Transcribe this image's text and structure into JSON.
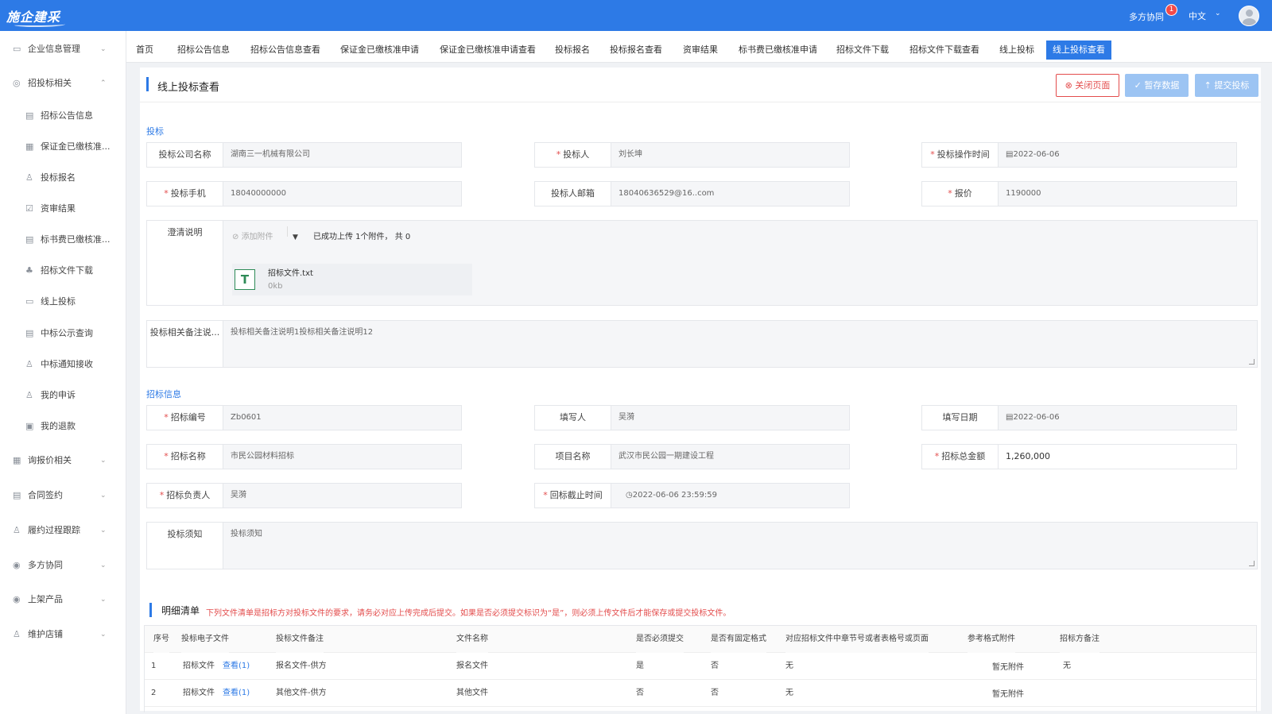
{
  "topbar": {
    "logo": "施企建采",
    "collab": "多方协同",
    "badge": "1",
    "lang": "中文"
  },
  "sidebar": {
    "items": [
      {
        "label": "企业信息管理",
        "icon": "document-icon",
        "chevron": "⌄"
      },
      {
        "label": "招投标相关",
        "icon": "target-icon",
        "chevron": "⌃"
      },
      {
        "label": "招标公告信息",
        "icon": "document-icon"
      },
      {
        "label": "保证金已缴核准...",
        "icon": "clipboard-icon"
      },
      {
        "label": "投标报名",
        "icon": "user-icon"
      },
      {
        "label": "资审结果",
        "icon": "check-icon"
      },
      {
        "label": "标书费已缴核准...",
        "icon": "document-icon"
      },
      {
        "label": "招标文件下载",
        "icon": "org-icon"
      },
      {
        "label": "线上投标",
        "icon": "edit-icon"
      },
      {
        "label": "中标公示查询",
        "icon": "list-icon"
      },
      {
        "label": "中标通知接收",
        "icon": "user-icon"
      },
      {
        "label": "我的申诉",
        "icon": "user-icon"
      },
      {
        "label": "我的退款",
        "icon": "refund-icon"
      },
      {
        "label": "询报价相关",
        "icon": "table-icon",
        "chevron": "⌄"
      },
      {
        "label": "合同签约",
        "icon": "contract-icon",
        "chevron": "⌄"
      },
      {
        "label": "履约过程跟踪",
        "icon": "user-icon",
        "chevron": "⌄"
      },
      {
        "label": "多方协同",
        "icon": "eye-icon",
        "chevron": "⌄"
      },
      {
        "label": "上架产品",
        "icon": "eye-icon",
        "chevron": "⌄"
      },
      {
        "label": "维护店铺",
        "icon": "user-icon",
        "chevron": "⌄"
      }
    ]
  },
  "tabs": [
    "首页",
    "招标公告信息",
    "招标公告信息查看",
    "保证金已缴核准申请",
    "保证金已缴核准申请查看",
    "投标报名",
    "投标报名查看",
    "资审结果",
    "标书费已缴核准申请",
    "招标文件下载",
    "招标文件下载查看",
    "线上投标",
    "线上投标查看"
  ],
  "header": {
    "title": "线上投标查看",
    "close": "关闭页面",
    "save": "暂存数据",
    "submit": "提交投标"
  },
  "bid": {
    "section": "投标",
    "company_label": "投标公司名称",
    "company": "湖南三一机械有限公司",
    "bidder_label": "投标人",
    "bidder": "刘长坤",
    "op_time_label": "投标操作时间",
    "op_time": "2022-06-06",
    "phone_label": "投标手机",
    "phone": "18040000000",
    "email_label": "投标人邮箱",
    "email": "18040636529@16..com",
    "price_label": "报价",
    "price": "1190000",
    "clarify_label": "澄清说明",
    "add_attach": "添加附件",
    "upload_status": "已成功上传 1个附件， 共 0",
    "file_name": "招标文件.txt",
    "file_size": "0kb",
    "file_icon": "T",
    "remark_label": "投标相关备注说...",
    "remark": "投标相关备注说明1投标相关备注说明12"
  },
  "tender": {
    "section": "招标信息",
    "no_label": "招标编号",
    "no": "Zb0601",
    "writer_label": "填写人",
    "writer": "吴漪",
    "date_label": "填写日期",
    "date": "2022-06-06",
    "name_label": "招标名称",
    "name": "市民公园材料招标",
    "project_label": "项目名称",
    "project": "武汉市民公园一期建设工程",
    "total_label": "招标总金额",
    "total": "1,260,000",
    "owner_label": "招标负责人",
    "owner": "吴漪",
    "deadline_label": "回标截止时间",
    "deadline": "2022-06-06 23:59:59",
    "notice_label": "投标须知",
    "notice": "投标须知"
  },
  "detail": {
    "title": "明细清单",
    "note": "下列文件清单是招标方对投标文件的要求，请务必对应上传完成后提交。如果是否必须提交标识为“是”，则必须上传文件后才能保存或提交投标文件。",
    "columns": [
      "序号",
      "投标电子文件",
      "投标文件备注",
      "文件名称",
      "是否必须提交",
      "是否有固定格式",
      "对应招标文件中章节号或者表格号或页面",
      "参考格式附件",
      "招标方备注"
    ],
    "rows": [
      {
        "no": "1",
        "file": "招标文件",
        "view": "查看(1)",
        "remark": "报名文件-供方",
        "name": "报名文件",
        "required": "是",
        "fixed": "否",
        "chapter": "无",
        "ref": "暂无附件",
        "note": "无"
      },
      {
        "no": "2",
        "file": "招标文件",
        "view": "查看(1)",
        "remark": "其他文件-供方",
        "name": "其他文件",
        "required": "否",
        "fixed": "否",
        "chapter": "无",
        "ref": "暂无附件",
        "note": ""
      }
    ]
  }
}
